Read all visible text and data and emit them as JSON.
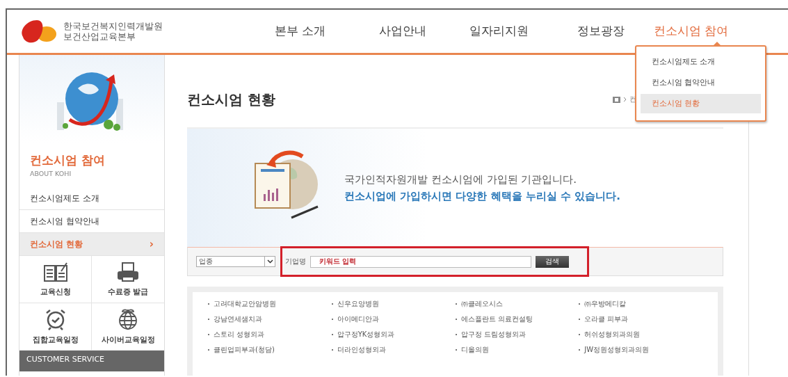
{
  "logo": {
    "line1": "한국보건복지인력개발원",
    "line2": "보건산업교육본부"
  },
  "nav": [
    {
      "label": "본부 소개",
      "selected": false
    },
    {
      "label": "사업안내",
      "selected": false
    },
    {
      "label": "일자리지원",
      "selected": false
    },
    {
      "label": "정보광장",
      "selected": false
    },
    {
      "label": "컨소시엄 참여",
      "selected": true
    }
  ],
  "dropdown": {
    "items": [
      {
        "label": "컨소시엄제도 소개",
        "selected": false
      },
      {
        "label": "컨소시엄 협약안내",
        "selected": false
      },
      {
        "label": "컨소시엄 현황",
        "selected": true
      }
    ]
  },
  "sidebar": {
    "title": "컨소시엄 참여",
    "subtitle": "ABOUT KOHI",
    "items": [
      {
        "label": "컨소시엄제도 소개",
        "selected": false
      },
      {
        "label": "컨소시엄 협약안내",
        "selected": false
      },
      {
        "label": "컨소시엄 현황",
        "selected": true
      }
    ],
    "chevron": "›",
    "quick_links": [
      {
        "label": "교육신청",
        "kind": "book"
      },
      {
        "label": "수료증 발급",
        "kind": "printer"
      },
      {
        "label": "집합교육일정",
        "kind": "clock"
      },
      {
        "label": "사이버교육일정",
        "kind": "globe"
      }
    ],
    "customer_service": "CUSTOMER SERVICE"
  },
  "page_title": "컨소시엄 현황",
  "breadcrumb": "컨",
  "intro": {
    "line1": "국가인적자원개발 컨소시엄에 가입된 기관입니다.",
    "line2": "컨소시업에 가입하시면 다양한 혜택을 누리실 수 있습니다."
  },
  "search": {
    "category": "업종",
    "label": "기업명",
    "value": "키워드 입력",
    "button": "검색"
  },
  "companies": [
    "고려대학교안암병원",
    "신우요양병원",
    "㈜클레오시스",
    "㈜우방메디칼",
    "강남연세샘치과",
    "아이메디안과",
    "에스플란트 의료컨설팅",
    "오라클 피부과",
    "스토리 성형외과",
    "압구정YK성형외과",
    "압구정 드림성형외과",
    "허쉬성형외과의원",
    "클린업피부과(청담)",
    "더라인성형외과",
    "디올의원",
    "JW정원성형외과의원"
  ]
}
